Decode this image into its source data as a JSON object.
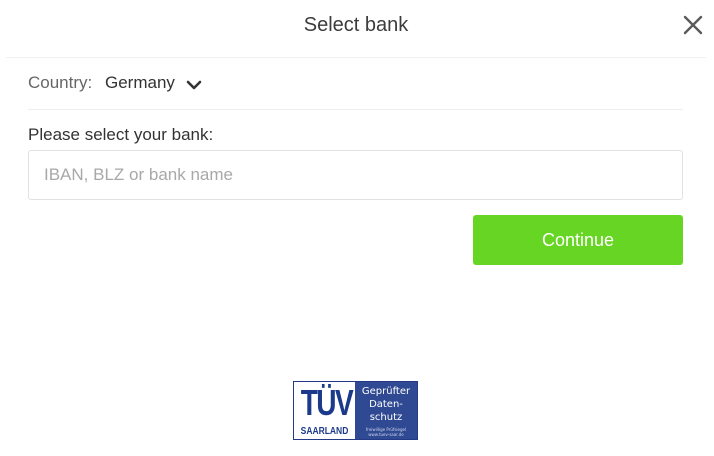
{
  "dialog": {
    "title": "Select bank",
    "close_icon": "close-icon"
  },
  "country": {
    "label": "Country:",
    "value": "Germany",
    "icon": "chevron-down-icon"
  },
  "bank_search": {
    "prompt": "Please select your bank:",
    "placeholder": "IBAN, BLZ or bank name",
    "value": ""
  },
  "continue_label": "Continue",
  "seal": {
    "mark": "TÜV",
    "region": "SAARLAND",
    "text": "Geprüfter Daten-schutz",
    "fine_print_1": "freiwillige Prüfsiegel",
    "fine_print_2": "www.tuev-saar.de"
  },
  "colors": {
    "accent_button": "#67d523",
    "seal_blue": "#2f4a92",
    "text_dark": "#333333",
    "placeholder": "#a8a8a8"
  }
}
